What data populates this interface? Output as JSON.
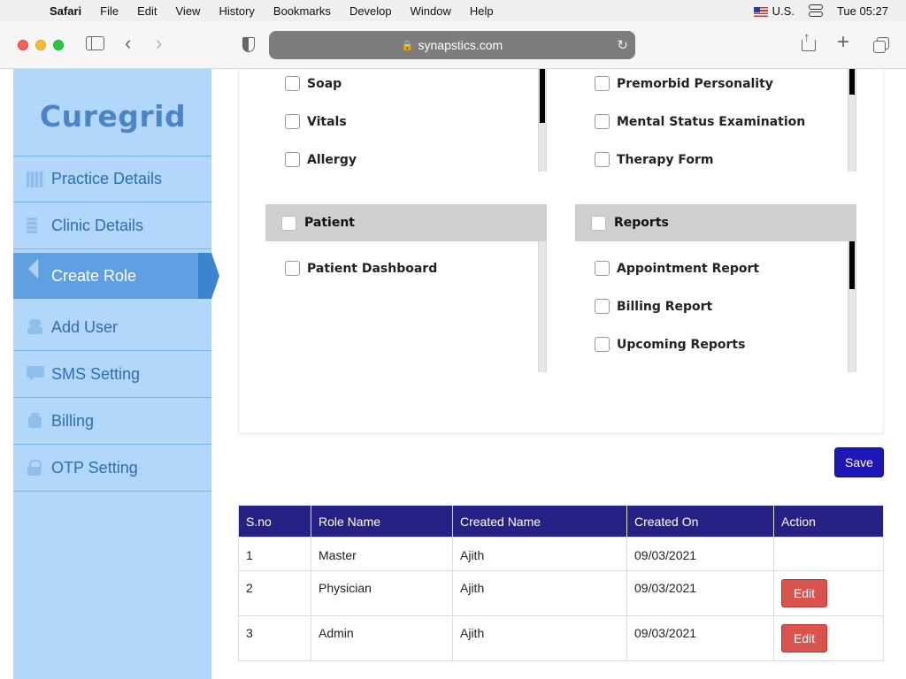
{
  "menubar": {
    "app": "Safari",
    "items": [
      "File",
      "Edit",
      "View",
      "History",
      "Bookmarks",
      "Develop",
      "Window",
      "Help"
    ],
    "input_source": "U.S.",
    "clock": "Tue 05:27"
  },
  "browser": {
    "url": "synapstics.com"
  },
  "sidebar": {
    "logo": "Curegrid",
    "items": [
      {
        "label": "Practice Details",
        "icon": "building-icon"
      },
      {
        "label": "Clinic Details",
        "icon": "clinic-icon"
      },
      {
        "label": "Create Role",
        "icon": "send-icon",
        "active": true
      },
      {
        "label": "Add User",
        "icon": "user-icon"
      },
      {
        "label": "SMS Setting",
        "icon": "sms-icon"
      },
      {
        "label": "Billing",
        "icon": "billing-icon"
      },
      {
        "label": "OTP Setting",
        "icon": "lock-icon"
      }
    ]
  },
  "permissions": {
    "top_left": [
      "Soap",
      "Vitals",
      "Allergy"
    ],
    "top_right": [
      "Premorbid Personality",
      "Mental Status Examination",
      "Therapy Form"
    ],
    "patient": {
      "title": "Patient",
      "items": [
        "Patient Dashboard"
      ]
    },
    "reports": {
      "title": "Reports",
      "items": [
        "Appointment Report",
        "Billing Report",
        "Upcoming Reports"
      ]
    }
  },
  "save_label": "Save",
  "roles_table": {
    "headers": [
      "S.no",
      "Role Name",
      "Created Name",
      "Created On",
      "Action"
    ],
    "rows": [
      {
        "sno": "1",
        "role": "Master",
        "created_by": "Ajith",
        "created_on": "09/03/2021",
        "action": ""
      },
      {
        "sno": "2",
        "role": "Physician",
        "created_by": "Ajith",
        "created_on": "09/03/2021",
        "action": "Edit"
      },
      {
        "sno": "3",
        "role": "Admin",
        "created_by": "Ajith",
        "created_on": "09/03/2021",
        "action": "Edit"
      }
    ]
  },
  "colors": {
    "sidebar_bg": "#b3d6fb",
    "active_item": "#5fa0e2",
    "table_header": "#262285",
    "save_button": "#1e17b6",
    "edit_button": "#d9534f"
  }
}
